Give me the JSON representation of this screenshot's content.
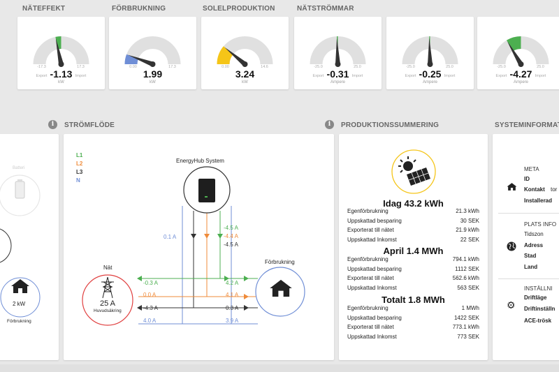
{
  "sections": {
    "nateffekt": "NÄTEFFEKT",
    "forbrukning": "FÖRBRUKNING",
    "solelproduktion": "SOLELPRODUKTION",
    "natstrommar": "NÄTSTRÖMMAR",
    "stromflode": "STRÖMFLÖDE",
    "produktionssummering": "PRODUKTIONSSUMMERING",
    "systeminformation": "SYSTEMINFORMATI"
  },
  "gauges": [
    {
      "value": "-1.13",
      "unit": "kW",
      "min": "-17.3",
      "max": "17.3",
      "left_label": "Export",
      "right_label": "Import",
      "fill_fraction": -0.065,
      "fill_color": "#4caf50"
    },
    {
      "value": "1.99",
      "unit": "kW",
      "min": "0.00",
      "max": "17.3",
      "left_label": "",
      "right_label": "",
      "fill_fraction": 0.115,
      "fill_color": "#6f8ed6"
    },
    {
      "value": "3.24",
      "unit": "kW",
      "min": "0.00",
      "max": "14.6",
      "left_label": "",
      "right_label": "",
      "fill_fraction": 0.222,
      "fill_color": "#f5c518"
    },
    {
      "value": "-0.31",
      "unit": "Ampere",
      "min": "-25.0",
      "max": "25.0",
      "left_label": "Export",
      "right_label": "Import",
      "fill_fraction": -0.012,
      "fill_color": "#4caf50"
    },
    {
      "value": "-0.25",
      "unit": "Ampere",
      "min": "-25.0",
      "max": "25.0",
      "left_label": "Export",
      "right_label": "Import",
      "fill_fraction": -0.01,
      "fill_color": "#4caf50"
    },
    {
      "value": "-4.27",
      "unit": "Ampere",
      "min": "-25.0",
      "max": "25.0",
      "left_label": "Export",
      "right_label": "Import",
      "fill_fraction": -0.171,
      "fill_color": "#4caf50"
    }
  ],
  "left_panel": {
    "battery_label": "Batteri",
    "consumption_value": "2 kW",
    "consumption_label": "Förbrukning"
  },
  "flow": {
    "legend": [
      "L1",
      "L2",
      "L3",
      "N"
    ],
    "legend_colors": [
      "#4caf50",
      "#ef8b3a",
      "#333333",
      "#6f8ed6"
    ],
    "system_label": "EnergyHub System",
    "grid_label": "Nät",
    "grid_fuse": "25 A",
    "grid_fuse_label": "Huvudsäkring",
    "consumption_label": "Förbrukning",
    "hub_n": "0.1 A",
    "hub_l1": "-4.5 A",
    "hub_l2": "-4.4 A",
    "hub_l3": "-4.5 A",
    "grid_l1": "-0.3 A",
    "grid_l2": "0.0 A",
    "grid_l3": "-4.3 A",
    "grid_n": "4.0 A",
    "cons_l1": "4.2 A",
    "cons_l2": "4.1 A",
    "cons_l3": "0.3 A",
    "cons_n": "3.9 A"
  },
  "production": {
    "today_title": "Idag 43.2 kWh",
    "today": [
      {
        "label": "Egenförbrukning",
        "value": "21.3 kWh"
      },
      {
        "label": "Uppskattad besparing",
        "value": "30 SEK"
      },
      {
        "label": "Exporterat till nätet",
        "value": "21.9 kWh"
      },
      {
        "label": "Uppskattad Inkomst",
        "value": "22 SEK"
      }
    ],
    "month_title": "April 1.4 MWh",
    "month": [
      {
        "label": "Egenförbrukning",
        "value": "794.1 kWh"
      },
      {
        "label": "Uppskattad besparing",
        "value": "1112 SEK"
      },
      {
        "label": "Exporterat till nätet",
        "value": "562.6 kWh"
      },
      {
        "label": "Uppskattad Inkomst",
        "value": "563 SEK"
      }
    ],
    "total_title": "Totalt 1.8 MWh",
    "total": [
      {
        "label": "Egenförbrukning",
        "value": "1 MWh"
      },
      {
        "label": "Uppskattad besparing",
        "value": "1422 SEK"
      },
      {
        "label": "Exporterat till nätet",
        "value": "773.1 kWh"
      },
      {
        "label": "Uppskattad Inkomst",
        "value": "773 SEK"
      }
    ]
  },
  "sysinfo": {
    "meta_title": "META",
    "meta": [
      "ID",
      "Kontakt",
      "Installerad"
    ],
    "meta_value_contact": "tor",
    "place_title": "PLATS INFO",
    "place": [
      "Tidszon",
      "Adress",
      "Stad",
      "Land"
    ],
    "settings_title": "INSTÄLLNI",
    "settings": [
      "Driftläge",
      "Driftinställn",
      "ACE-trösk"
    ]
  }
}
